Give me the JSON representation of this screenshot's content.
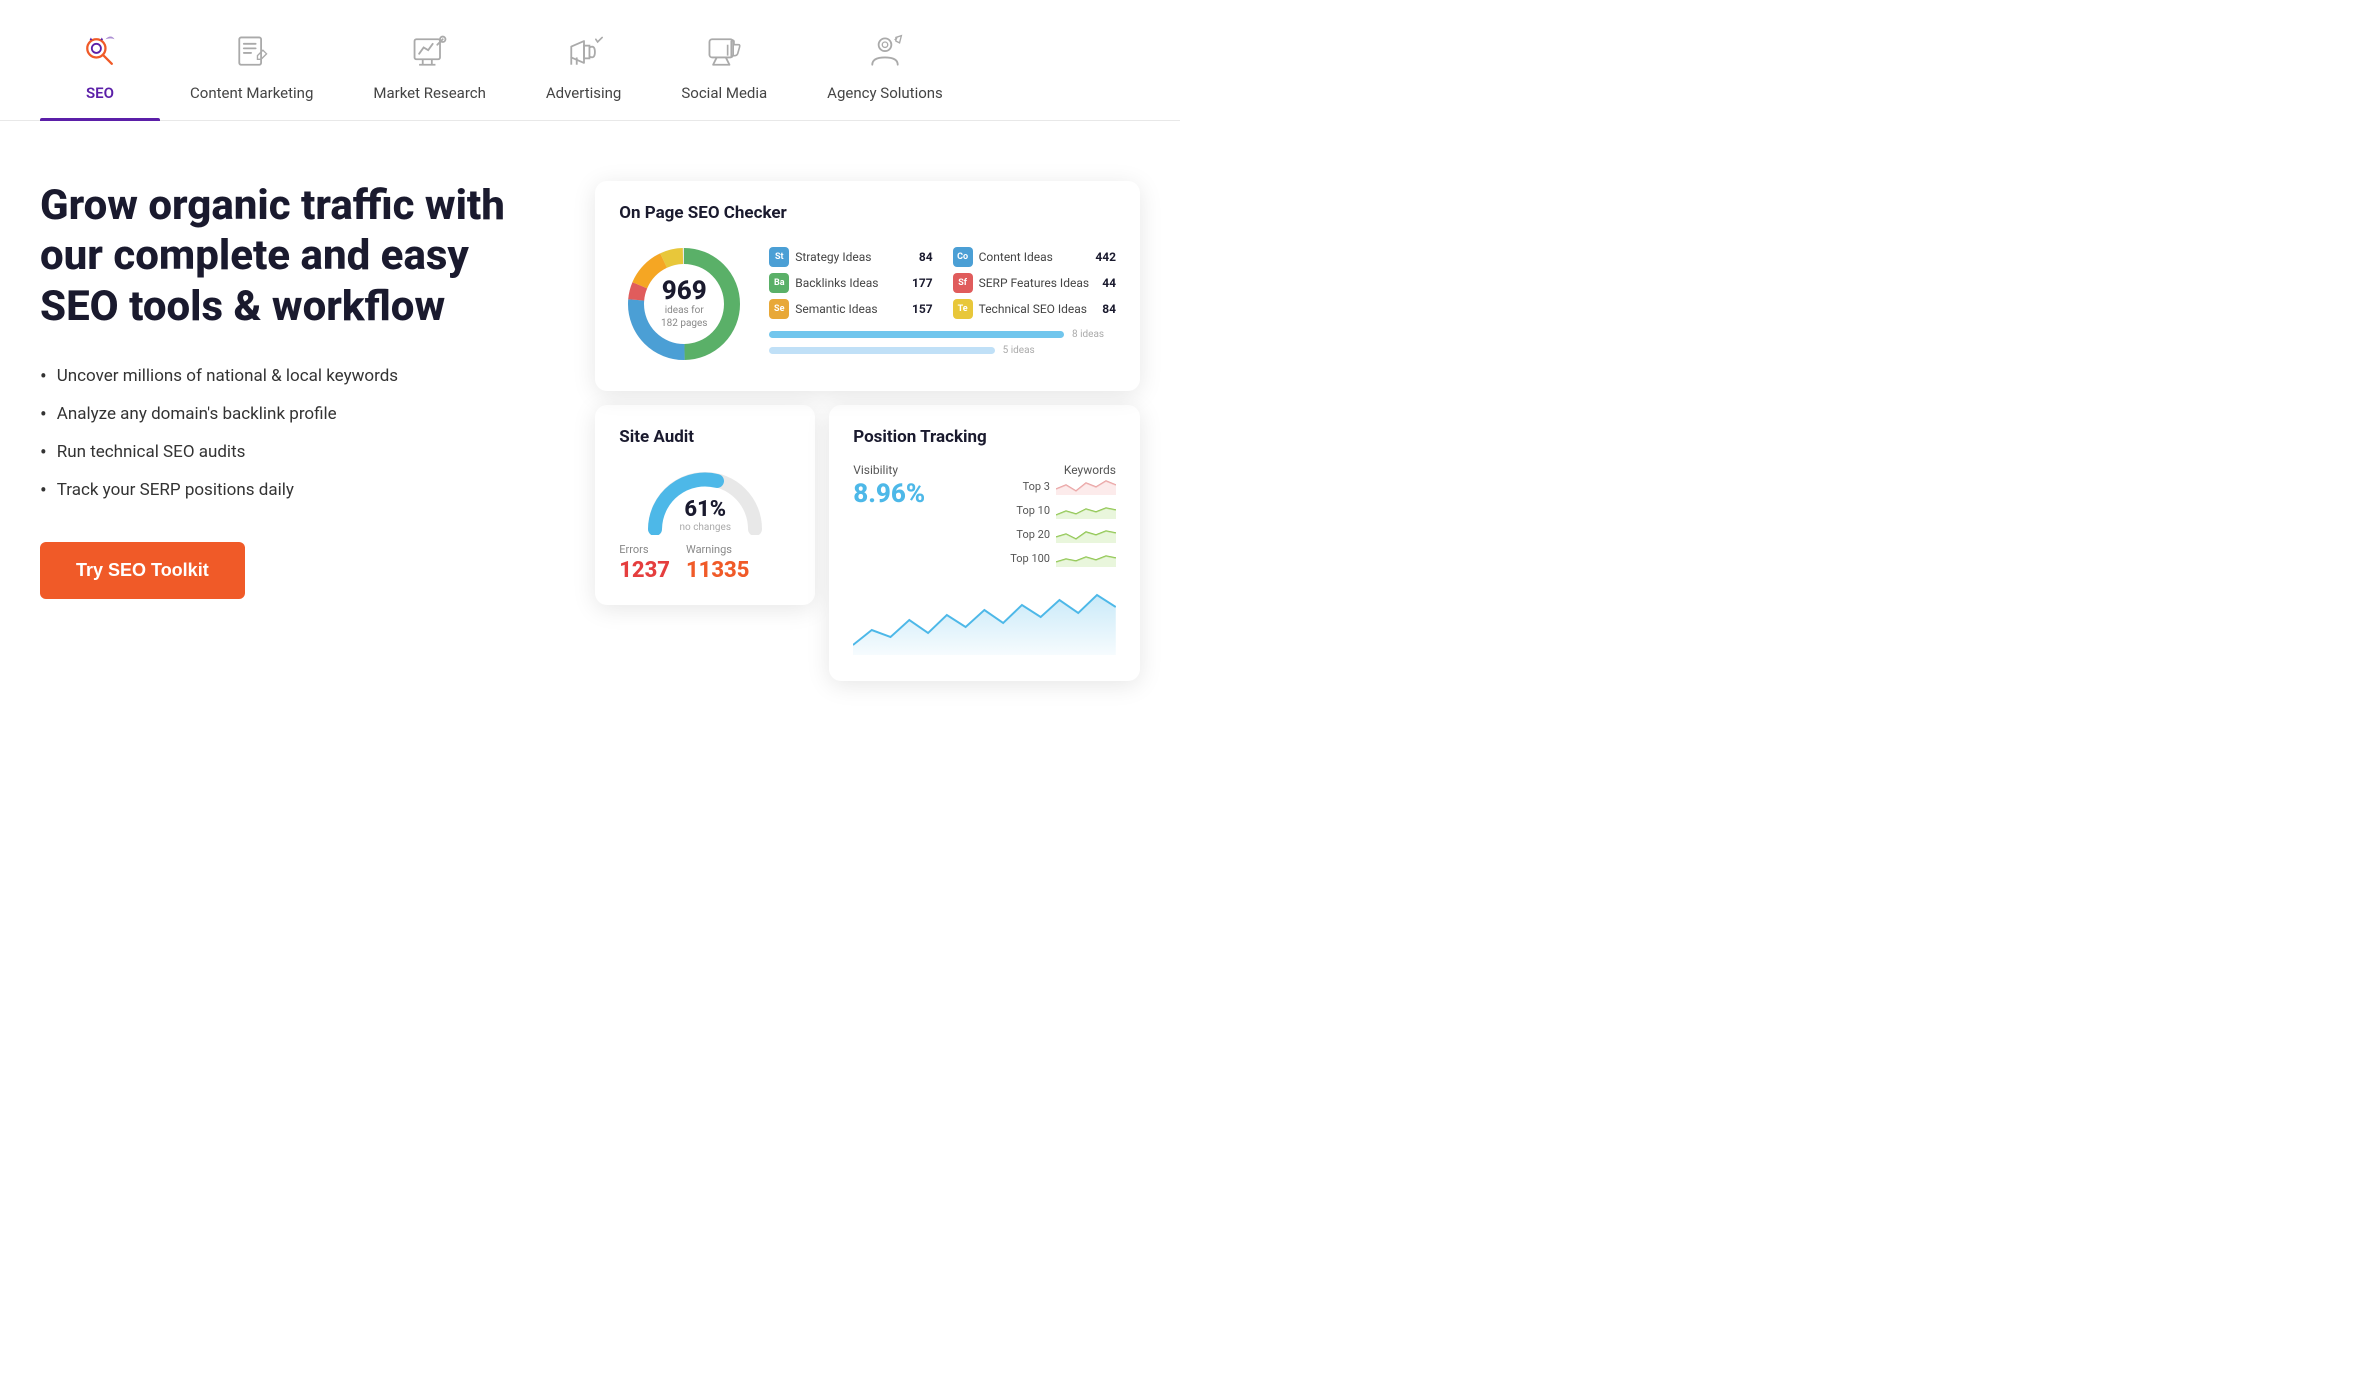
{
  "nav": {
    "items": [
      {
        "id": "seo",
        "label": "SEO",
        "active": true
      },
      {
        "id": "content-marketing",
        "label": "Content Marketing",
        "active": false
      },
      {
        "id": "market-research",
        "label": "Market Research",
        "active": false
      },
      {
        "id": "advertising",
        "label": "Advertising",
        "active": false
      },
      {
        "id": "social-media",
        "label": "Social Media",
        "active": false
      },
      {
        "id": "agency-solutions",
        "label": "Agency Solutions",
        "active": false
      }
    ]
  },
  "hero": {
    "headline": "Grow organic traffic with our complete and easy SEO tools & workflow",
    "bullets": [
      "Uncover millions of national & local keywords",
      "Analyze any domain's backlink profile",
      "Run technical SEO audits",
      "Track your SERP positions daily"
    ],
    "cta_label": "Try SEO Toolkit"
  },
  "seo_checker": {
    "title": "On Page SEO Checker",
    "total": "969",
    "sub_line1": "ideas for",
    "sub_line2": "182 pages",
    "ideas": [
      {
        "badge": "St",
        "color": "#4b9fd5",
        "label": "Strategy Ideas",
        "count": "84"
      },
      {
        "badge": "Ba",
        "color": "#5ab068",
        "label": "Backlinks Ideas",
        "count": "177"
      },
      {
        "badge": "Se",
        "color": "#e8a838",
        "label": "Semantic Ideas",
        "count": "157"
      },
      {
        "badge": "Co",
        "color": "#4b9fd5",
        "label": "Content Ideas",
        "count": "442"
      },
      {
        "badge": "Sf",
        "color": "#e05c5c",
        "label": "SERP Features Ideas",
        "count": "44"
      },
      {
        "badge": "Te",
        "color": "#e8c73a",
        "label": "Technical SEO Ideas",
        "count": "84"
      }
    ],
    "bars": [
      {
        "width": "85%",
        "label": "8 ideas"
      },
      {
        "width": "65%",
        "label": "5 ideas"
      }
    ]
  },
  "site_audit": {
    "title": "Site Audit",
    "percentage": "61%",
    "sub": "no changes",
    "errors_label": "Errors",
    "errors_val": "1237",
    "warnings_label": "Warnings",
    "warnings_val": "11335"
  },
  "position_tracking": {
    "title": "Position Tracking",
    "visibility_label": "Visibility",
    "visibility_pct": "8.96%",
    "keywords_label": "Keywords",
    "keywords": [
      {
        "label": "Top 3",
        "color": "#e8a0a0"
      },
      {
        "label": "Top 10",
        "color": "#8bc34a"
      },
      {
        "label": "Top 20",
        "color": "#8bc34a"
      },
      {
        "label": "Top 100",
        "color": "#8bc34a"
      }
    ]
  },
  "colors": {
    "accent_purple": "#5b1fa8",
    "accent_orange": "#f05a28",
    "accent_blue": "#4db8e8",
    "donut_green": "#5ab068",
    "donut_blue": "#4b9fd5",
    "donut_red": "#e05c5c",
    "donut_orange": "#f5a623",
    "donut_yellow": "#e8c73a"
  }
}
